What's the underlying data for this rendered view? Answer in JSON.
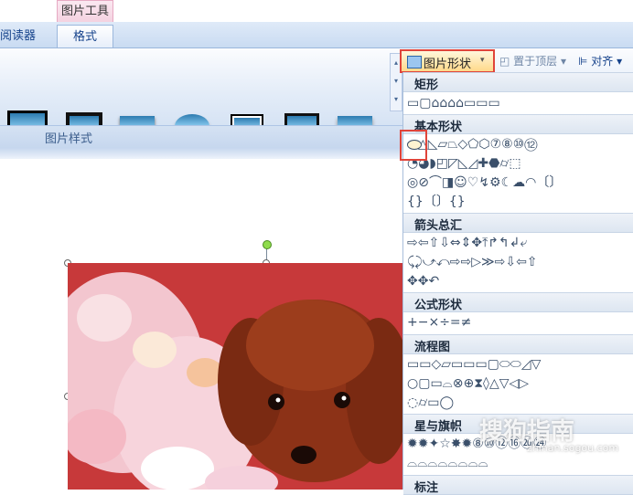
{
  "context_tab": "图片工具",
  "tabs": {
    "reader": "阅读器",
    "format": "格式"
  },
  "group_label": "图片样式",
  "toolbar": {
    "shape_label": "图片形状",
    "bring_front": "置于顶层",
    "align": "对齐"
  },
  "categories": {
    "rect": "矩形",
    "basic": "基本形状",
    "arrows": "箭头总汇",
    "equation": "公式形状",
    "flowchart": "流程图",
    "stars": "星与旗帜",
    "callouts": "标注"
  },
  "shape_rows": {
    "rect": "▭▢⌂⌂⌂⌂▭▭▭",
    "basic1": "⬭△◺▱⏢◇⬠⬡⑦⑧⑩⑫",
    "basic2": "◔◕◗◰◸◺◿✚⬣⌭⬚",
    "basic3": "◎⊘⌒◨☺♡↯⚙☾☁◠〔〕",
    "basic4": "{}〔〕{}",
    "arrows1": "⇨⇦⇧⇩⇔⇕✥⤒↱↰↲⤶",
    "arrows2": "⤹⤸⤻⤺⇨⇨▷≫⇨⇩⇦⇧",
    "arrows3": "✥✥↶",
    "equation": "+−×÷=≠",
    "flow1": "▭▭◇▱▭▭▭▢⬭⬭◿▽",
    "flow2": "○▢▭⌓⊗⊕⧗◊△▽◁▷",
    "flow3": "◌⌭▭◯",
    "stars1": "✹✹✦☆✸✹⑧⑩⑫⑯⑳㉔",
    "stars2": "⌓⌓⌓⌓⌓⌓⌓⌓"
  },
  "watermark": {
    "text": "搜狗指南",
    "url": "zhinan.sogou.com"
  }
}
